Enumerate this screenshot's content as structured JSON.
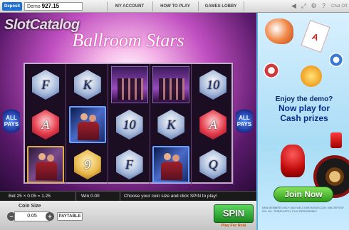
{
  "topbar": {
    "deposit_label": "Deposit",
    "demo_label": "Demo",
    "demo_balance": "927.15",
    "nav": [
      "MY ACCOUNT",
      "HOW TO PLAY",
      "GAMES LOBBY"
    ],
    "chat_label": "Chat Off"
  },
  "watermark": "SlotCatalog",
  "game": {
    "title": "Ballroom Stars",
    "all_pays": "ALL PAYS",
    "reels": [
      [
        {
          "kind": "hex",
          "color": "silver",
          "glyph": "F"
        },
        {
          "kind": "hex",
          "color": "red",
          "glyph": "A"
        },
        {
          "kind": "pic",
          "color": "gold"
        }
      ],
      [
        {
          "kind": "hex",
          "color": "silver",
          "glyph": "K"
        },
        {
          "kind": "pic",
          "color": "blue"
        },
        {
          "kind": "hex",
          "color": "gold",
          "glyph": "9"
        }
      ],
      [
        {
          "kind": "stage"
        },
        {
          "kind": "hex",
          "color": "silver",
          "glyph": "10"
        },
        {
          "kind": "hex",
          "color": "silver",
          "glyph": "F"
        }
      ],
      [
        {
          "kind": "stage"
        },
        {
          "kind": "hex",
          "color": "silver",
          "glyph": "K"
        },
        {
          "kind": "pic",
          "color": "blue"
        }
      ],
      [
        {
          "kind": "hex",
          "color": "silver",
          "glyph": "10"
        },
        {
          "kind": "hex",
          "color": "red",
          "glyph": "A"
        },
        {
          "kind": "hex",
          "color": "silver",
          "glyph": "Q"
        }
      ]
    ]
  },
  "info": {
    "bet": "Bet 25 × 0.05 = 1.25",
    "win": "Win 0.00",
    "message": "Choose your coin size and click SPIN to play!"
  },
  "controls": {
    "coin_size_label": "Coin Size",
    "coin_value": "0.05",
    "minus": "−",
    "plus": "+",
    "paytable_label": "PAYTABLE",
    "spin_label": "SPIN",
    "play_real": "Play For Real"
  },
  "ad": {
    "card_glyph": "A",
    "line1": "Enjoy the demo?",
    "line2": "Now play for",
    "line3": "Cash prizes",
    "join_label": "Join Now",
    "fine_print": "NEW MEMBERS ONLY. MAX WELCOME BONUS £200. MIN DEPOSIT £10. 18+. TERMS APPLY. PLAY RESPONSIBLY."
  },
  "colors": {
    "accent_green": "#2f9a1c",
    "ad_blue": "#0a2a6a",
    "deposit_blue": "#1e6fd0"
  }
}
